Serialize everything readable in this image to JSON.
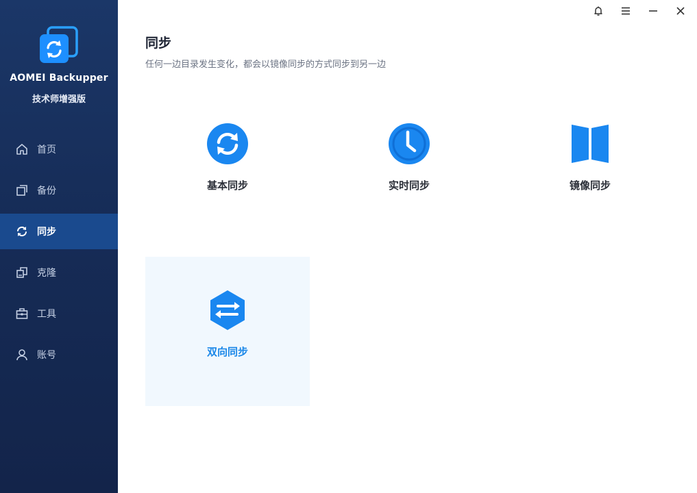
{
  "app": {
    "name": "AOMEI Backupper",
    "edition": "技术师增强版"
  },
  "sidebar": {
    "items": [
      {
        "label": "首页",
        "icon": "home-icon"
      },
      {
        "label": "备份",
        "icon": "backup-icon"
      },
      {
        "label": "同步",
        "icon": "sync-icon",
        "active": true
      },
      {
        "label": "克隆",
        "icon": "clone-icon"
      },
      {
        "label": "工具",
        "icon": "tools-icon"
      },
      {
        "label": "账号",
        "icon": "account-icon"
      }
    ]
  },
  "window_controls": [
    "bell-icon",
    "menu-icon",
    "minimize-icon",
    "close-icon"
  ],
  "main": {
    "title": "同步",
    "description": "任何一边目录发生变化，都会以镜像同步的方式同步到另一边",
    "options": [
      {
        "label": "基本同步",
        "icon": "basic-sync-icon"
      },
      {
        "label": "实时同步",
        "icon": "realtime-sync-clock-icon"
      },
      {
        "label": "镜像同步",
        "icon": "mirror-sync-icon"
      },
      {
        "label": "双向同步",
        "icon": "two-way-sync-icon",
        "selected": true
      }
    ]
  },
  "colors": {
    "sidebar_bg": "#162c57",
    "sidebar_active": "#1a4a8e",
    "accent": "#1a87e8",
    "selected_card_bg": "#f1f8fe"
  }
}
